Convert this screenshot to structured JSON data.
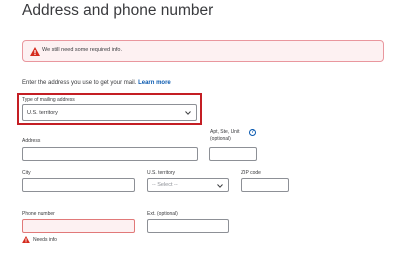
{
  "page": {
    "title": "Address and phone number"
  },
  "alert": {
    "message": "We still need some required info."
  },
  "intro": {
    "text": "Enter the address you use to get your mail.",
    "link": "Learn more"
  },
  "mailing_type": {
    "label": "Type of mailing address",
    "value": "U.S. territory"
  },
  "address": {
    "label": "Address",
    "value": ""
  },
  "apt": {
    "label_line1": "Apt, Ste, Unit",
    "label_line2": "(optional)",
    "value": ""
  },
  "city": {
    "label": "City",
    "value": ""
  },
  "territory": {
    "label": "U.S. territory",
    "placeholder": "-- Select --"
  },
  "zip": {
    "label": "ZIP code",
    "value": ""
  },
  "phone": {
    "label": "Phone number",
    "value": "",
    "error": "Needs info"
  },
  "ext": {
    "label": "Ext. (optional)",
    "value": ""
  },
  "icons": {
    "alert": "warning-triangle-icon",
    "help": "help-icon",
    "chevron": "chevron-down-icon"
  },
  "colors": {
    "error": "#d52b1e",
    "link": "#0a5ab0",
    "highlight": "#c41e24"
  }
}
